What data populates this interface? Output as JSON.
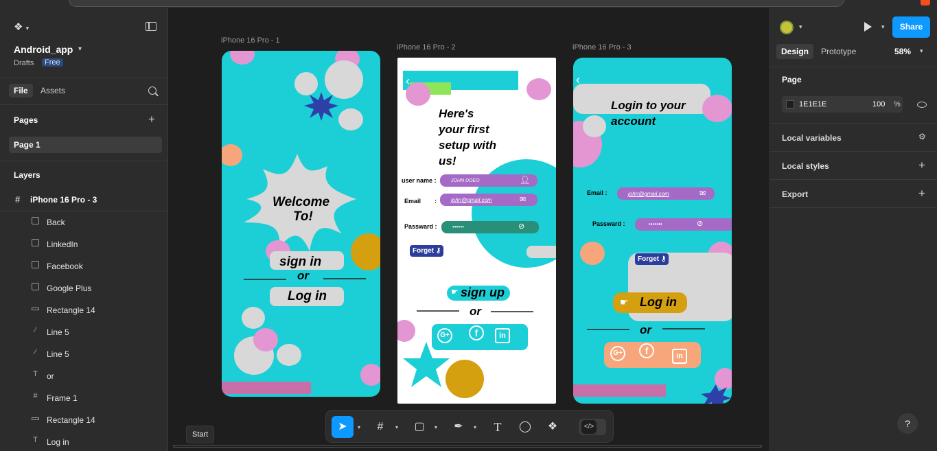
{
  "left_panel": {
    "project_name": "Android_app",
    "drafts": "Drafts",
    "plan_badge": "Free",
    "tabs": [
      "File",
      "Assets"
    ],
    "pages_title": "Pages",
    "page_item": "Page 1",
    "layers_title": "Layers",
    "top_layer": "iPhone 16 Pro - 3",
    "layers": [
      {
        "label": "Back",
        "icon": "image-icon"
      },
      {
        "label": "LinkedIn",
        "icon": "image-icon"
      },
      {
        "label": "Facebook",
        "icon": "image-icon"
      },
      {
        "label": "Google Plus",
        "icon": "image-icon"
      },
      {
        "label": "Rectangle 14",
        "icon": "rectangle-icon"
      },
      {
        "label": "Line 5",
        "icon": "line-icon"
      },
      {
        "label": "Line 5",
        "icon": "line-icon"
      },
      {
        "label": "or",
        "icon": "text-icon"
      },
      {
        "label": "Frame 1",
        "icon": "frame-icon"
      },
      {
        "label": "Rectangle 14",
        "icon": "rectangle-icon"
      },
      {
        "label": "Log in",
        "icon": "text-icon"
      }
    ]
  },
  "canvas": {
    "frame1": {
      "label": "iPhone 16 Pro - 1",
      "welcome": "Welcome",
      "to": "To!",
      "sign_in": "sign  in",
      "or": "or",
      "log_in": "Log in"
    },
    "frame2": {
      "label": "iPhone 16 Pro - 2",
      "heading_lines": [
        "Here's",
        "your first",
        "setup with",
        "us!"
      ],
      "username_label": "user name :",
      "username_value": "JOHN  DOEO",
      "email_label": "Email",
      "email_colon": ":",
      "email_value": "john@gmail.com",
      "password_label": "Passward  :",
      "password_value": "••••••",
      "forget": "Forget",
      "sign_up": "sign up",
      "or": "or"
    },
    "frame3": {
      "label": "iPhone 16 Pro - 3",
      "heading_lines": [
        "Login to your",
        "account"
      ],
      "email_label": "Email    :",
      "email_value": "john@gmail.com",
      "password_label": "Passward  :",
      "password_value": "•••••••",
      "forget": "Forget",
      "log_in": "Log in",
      "or": "or"
    },
    "colors": {
      "teal": "#1ccfd7",
      "pink": "#e396d1",
      "mustard": "#d4a010",
      "peach": "#f6a67a",
      "purple_field": "#a46ac6",
      "green_field": "#2a8f79",
      "blue_star": "#2f3fa8",
      "light_gray": "#d8d8d8"
    }
  },
  "toolbar": {
    "tooltip": "Start",
    "tools": [
      "move-tool-icon",
      "frame-tool-icon",
      "rectangle-tool-icon",
      "pen-tool-icon",
      "text-tool-icon",
      "comment-tool-icon",
      "components-icon",
      "dev-mode-icon"
    ]
  },
  "right_panel": {
    "share": "Share",
    "tabs": [
      "Design",
      "Prototype"
    ],
    "zoom": "58%",
    "page_title": "Page",
    "bg_hex": "1E1E1E",
    "bg_opacity": "100",
    "pct": "%",
    "sections": [
      "Local variables",
      "Local styles",
      "Export"
    ],
    "help": "?"
  }
}
